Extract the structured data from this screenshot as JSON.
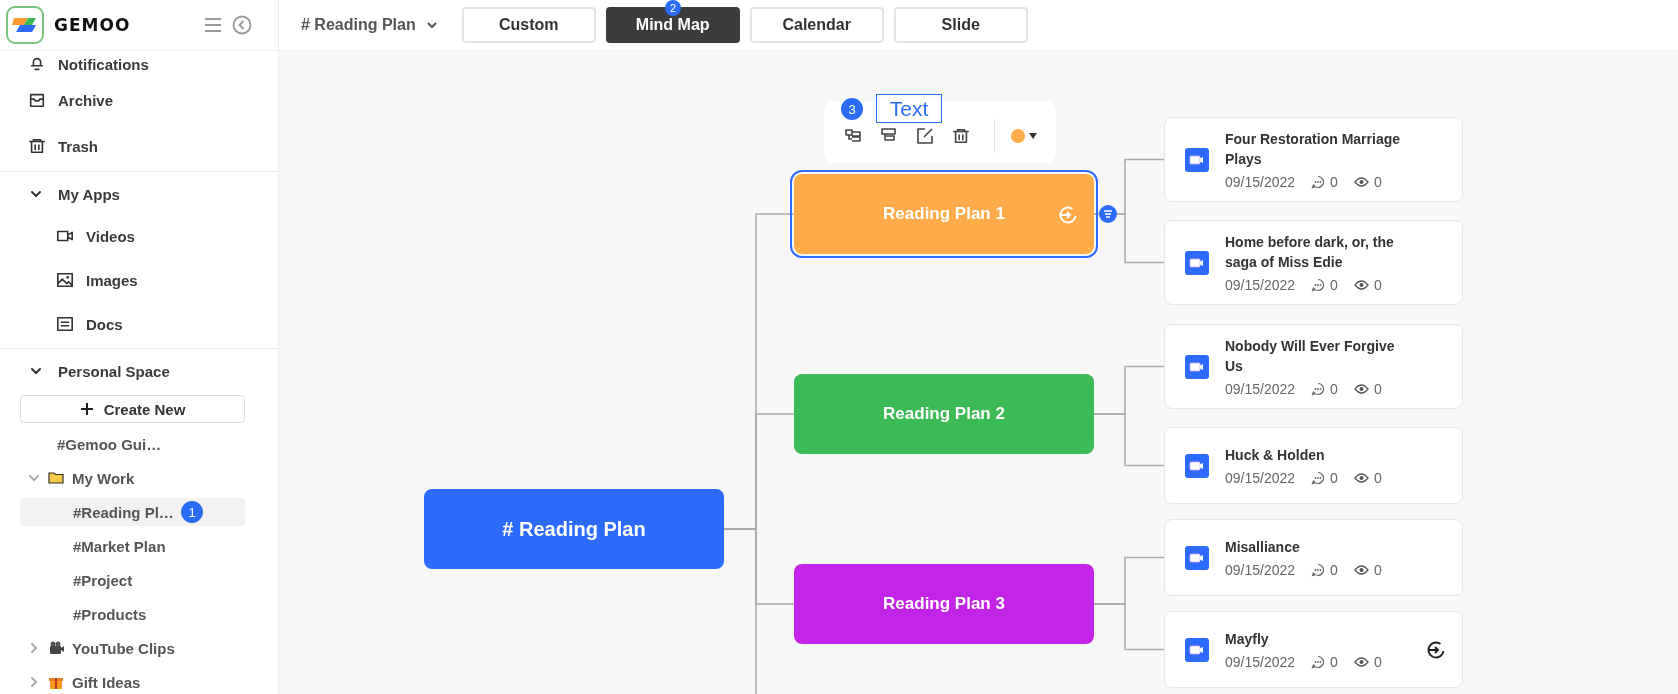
{
  "app": {
    "name": "GEMOO"
  },
  "sidebar": {
    "nav": [
      {
        "label": "Notifications"
      },
      {
        "label": "Archive"
      },
      {
        "label": "Trash"
      }
    ],
    "my_apps": {
      "label": "My Apps",
      "expanded": true,
      "items": [
        {
          "label": "Videos"
        },
        {
          "label": "Images"
        },
        {
          "label": "Docs"
        }
      ]
    },
    "personal_space": {
      "label": "Personal Space",
      "expanded": true,
      "create_button": "Create New",
      "tree": [
        {
          "kind": "page",
          "label": "#Gemoo Gui…",
          "selected": false
        },
        {
          "kind": "folder",
          "label": "My Work",
          "expanded": true,
          "selected": false,
          "children": [
            {
              "label": "#Reading Pl…",
              "selected": true,
              "badge": "1"
            },
            {
              "label": "#Market Plan",
              "selected": false
            },
            {
              "label": "#Project",
              "selected": false
            },
            {
              "label": "#Products",
              "selected": false
            }
          ]
        },
        {
          "kind": "folder",
          "label": "YouTube Clips",
          "expanded": false,
          "selected": false
        },
        {
          "kind": "folder",
          "label": "Gift Ideas",
          "expanded": false,
          "selected": false
        }
      ]
    }
  },
  "topbar": {
    "doc_title": "# Reading Plan",
    "views": [
      {
        "label": "Custom",
        "selected": false
      },
      {
        "label": "Mind Map",
        "selected": true,
        "badge": "2"
      },
      {
        "label": "Calendar",
        "selected": false
      },
      {
        "label": "Slide",
        "selected": false
      }
    ]
  },
  "mindmap": {
    "toolbar": {
      "badge": "3",
      "annotation": "Text",
      "color": "#ffab4a"
    },
    "root": "# Reading Plan",
    "branches": [
      {
        "label": "Reading Plan 1",
        "color": "#ffab4a",
        "selected": true,
        "cards": [
          {
            "title": "Four Restoration Marriage Plays",
            "date": "09/15/2022",
            "comments": "0",
            "views": "0",
            "hovered": false
          },
          {
            "title": "Home before dark, or, the saga of Miss Edie",
            "date": "09/15/2022",
            "comments": "0",
            "views": "0",
            "hovered": false
          }
        ]
      },
      {
        "label": "Reading Plan 2",
        "color": "#3bba56",
        "selected": false,
        "cards": [
          {
            "title": "Nobody Will Ever Forgive Us",
            "date": "09/15/2022",
            "comments": "0",
            "views": "0",
            "hovered": false
          },
          {
            "title": "Huck & Holden",
            "date": "09/15/2022",
            "comments": "0",
            "views": "0",
            "hovered": false
          }
        ]
      },
      {
        "label": "Reading Plan 3",
        "color": "#c324e8",
        "selected": false,
        "cards": [
          {
            "title": "Misalliance",
            "date": "09/15/2022",
            "comments": "0",
            "views": "0",
            "hovered": false
          },
          {
            "title": "Mayfly",
            "date": "09/15/2022",
            "comments": "0",
            "views": "0",
            "hovered": true
          }
        ]
      }
    ]
  }
}
